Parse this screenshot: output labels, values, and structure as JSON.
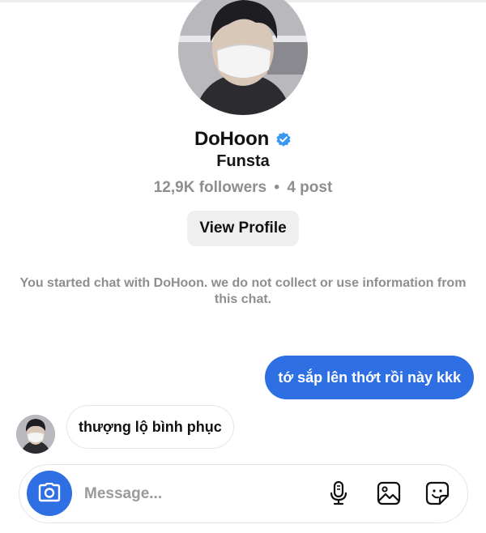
{
  "profile": {
    "name": "DoHoon",
    "subtitle": "Funsta",
    "followers": "12,9K followers",
    "separator": "•",
    "posts": "4 post",
    "view_profile_label": "View Profile"
  },
  "chat": {
    "notice": "You started chat with DoHoon. we do not collect or use information from this chat.",
    "messages": [
      {
        "direction": "outgoing",
        "text": "tớ sắp lên thớt rồi này kkk"
      },
      {
        "direction": "incoming",
        "text": "thượng lộ bình phục"
      }
    ]
  },
  "composer": {
    "placeholder": "Message...",
    "icons": [
      "camera-icon",
      "microphone-icon",
      "gallery-icon",
      "sticker-icon"
    ]
  },
  "colors": {
    "accent": "#2f6fe4",
    "verified": "#3897f0",
    "muted_text": "#8e8e8e",
    "button_bg": "#efefef"
  }
}
